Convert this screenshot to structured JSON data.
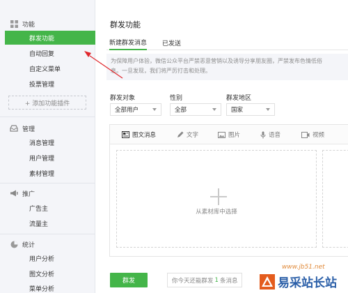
{
  "sidebar": {
    "sections": [
      {
        "title": "功能",
        "icon": "grid-icon",
        "items": [
          {
            "label": "群发功能",
            "active": true
          },
          {
            "label": "自动回复"
          },
          {
            "label": "自定义菜单"
          },
          {
            "label": "投票管理"
          }
        ],
        "add_plugin": "+ 添加功能插件"
      },
      {
        "title": "管理",
        "icon": "tray-icon",
        "items": [
          {
            "label": "消息管理"
          },
          {
            "label": "用户管理"
          },
          {
            "label": "素材管理"
          }
        ]
      },
      {
        "title": "推广",
        "icon": "megaphone-icon",
        "items": [
          {
            "label": "广告主"
          },
          {
            "label": "流量主"
          }
        ]
      },
      {
        "title": "统计",
        "icon": "pie-chart-icon",
        "items": [
          {
            "label": "用户分析"
          },
          {
            "label": "图文分析"
          },
          {
            "label": "菜单分析"
          }
        ]
      }
    ]
  },
  "main": {
    "title": "群发功能",
    "tabs": [
      {
        "label": "新建群发消息",
        "active": true
      },
      {
        "label": "已发送"
      }
    ],
    "notice_line1": "为保障用户体验，微信公众平台严禁恶意营销以及诱导分享朋友圈，严禁发布色情低俗",
    "notice_line2": "息。一旦发现，我们将严厉打击和处理。",
    "filters": [
      {
        "label": "群发对象",
        "value": "全部用户"
      },
      {
        "label": "性别",
        "value": "全部"
      },
      {
        "label": "群发地区",
        "value": "国家"
      }
    ],
    "editor_tabs": [
      {
        "label": "图文消息",
        "icon": "article-icon",
        "active": true
      },
      {
        "label": "文字",
        "icon": "pen-icon"
      },
      {
        "label": "图片",
        "icon": "image-icon"
      },
      {
        "label": "语音",
        "icon": "microphone-icon"
      },
      {
        "label": "视频",
        "icon": "video-icon"
      }
    ],
    "material_hint": "从素材库中选择",
    "send_label": "群发",
    "quota_prefix": "你今天还能群发",
    "quota_count": "1",
    "quota_suffix": "条消息"
  },
  "watermark": {
    "url": "www.jb51.net",
    "brand": "易采站长站"
  },
  "colors": {
    "accent": "#44b549",
    "annotation_arrow": "#e0262b",
    "sidebar_bg": "#f4f5f9"
  }
}
